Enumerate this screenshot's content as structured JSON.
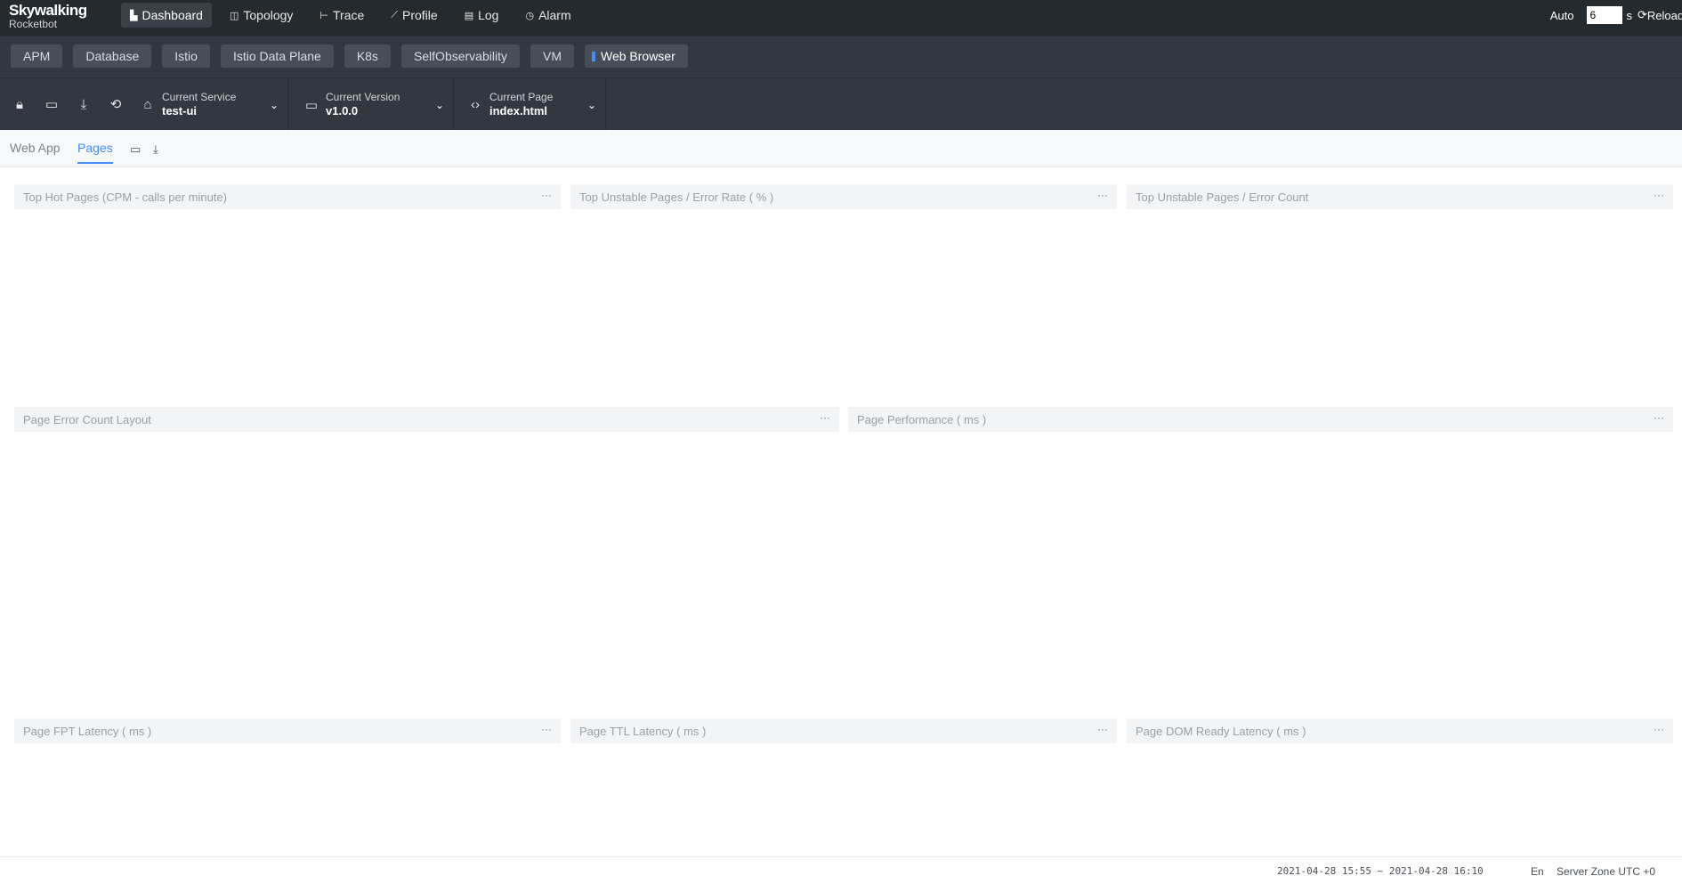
{
  "app": {
    "brand": "Skywalking",
    "subtitle": "Rocketbot"
  },
  "nav": [
    {
      "label": "Dashboard",
      "icon": "dashboard-icon",
      "active": true
    },
    {
      "label": "Topology",
      "icon": "topology-icon",
      "active": false
    },
    {
      "label": "Trace",
      "icon": "trace-icon",
      "active": false
    },
    {
      "label": "Profile",
      "icon": "profile-icon",
      "active": false
    },
    {
      "label": "Log",
      "icon": "log-icon",
      "active": false
    },
    {
      "label": "Alarm",
      "icon": "alarm-icon",
      "active": false
    }
  ],
  "auto_refresh": {
    "label": "Auto",
    "interval": "6",
    "unit": "s",
    "reload_label": "Reload"
  },
  "categories": [
    "APM",
    "Database",
    "Istio",
    "Istio Data Plane",
    "K8s",
    "SelfObservability",
    "VM",
    "Web Browser"
  ],
  "active_category": "Web Browser",
  "selectors": {
    "service": {
      "label": "Current Service",
      "value": "test-ui"
    },
    "version": {
      "label": "Current Version",
      "value": "v1.0.0"
    },
    "page": {
      "label": "Current Page",
      "value": "index.html"
    }
  },
  "tabs": [
    "Web App",
    "Pages"
  ],
  "active_tab": "Pages",
  "panels": {
    "hot_pages": "Top Hot Pages (CPM - calls per minute)",
    "unstable_rate": "Top Unstable Pages / Error Rate ( % )",
    "unstable_count": "Top Unstable Pages / Error Count",
    "error_layout": "Page Error Count Layout",
    "performance": "Page Performance ( ms )",
    "fpt": "Page FPT Latency ( ms )",
    "ttl": "Page TTL Latency ( ms )",
    "dom_ready": "Page DOM Ready Latency ( ms )",
    "more": "···"
  },
  "footer": {
    "time_range": "2021-04-28 15:55 ~ 2021-04-28 16:10",
    "language": "En",
    "server_zone": "Server Zone UTC +0"
  },
  "colors": {
    "topbar": "#252a2f",
    "toolbar": "#333840",
    "accent": "#448dfe"
  }
}
